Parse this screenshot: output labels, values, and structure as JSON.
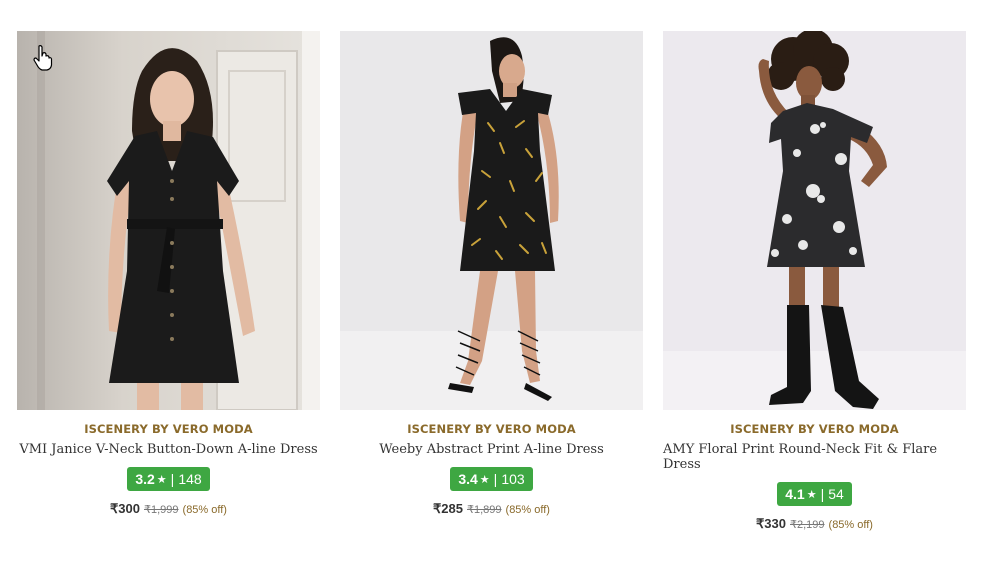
{
  "products": [
    {
      "brand": "ISCENERY BY VERO MODA",
      "title": "VMI Janice V-Neck Button-Down A-line Dress",
      "rating": "3.2",
      "star": "★",
      "separator": "|",
      "reviews": "148",
      "price": "₹300",
      "mrp": "₹1,999",
      "discount": "(85% off)",
      "rating_color": "#3ea742"
    },
    {
      "brand": "ISCENERY BY VERO MODA",
      "title": "Weeby Abstract Print A-line Dress",
      "rating": "3.4",
      "star": "★",
      "separator": "|",
      "reviews": "103",
      "price": "₹285",
      "mrp": "₹1,899",
      "discount": "(85% off)",
      "rating_color": "#3ea742"
    },
    {
      "brand": "ISCENERY BY VERO MODA",
      "title": "AMY Floral Print Round-Neck Fit & Flare Dress",
      "rating": "4.1",
      "star": "★",
      "separator": "|",
      "reviews": "54",
      "price": "₹330",
      "mrp": "₹2,199",
      "discount": "(85% off)",
      "rating_color": "#3ea742"
    }
  ],
  "colors": {
    "brand_text": "#8a6a2b",
    "title_text": "#333333",
    "rating_badge": "#3ea742"
  },
  "icons": {
    "cursor": "hand-pointer-cursor-icon",
    "star": "star-icon"
  }
}
